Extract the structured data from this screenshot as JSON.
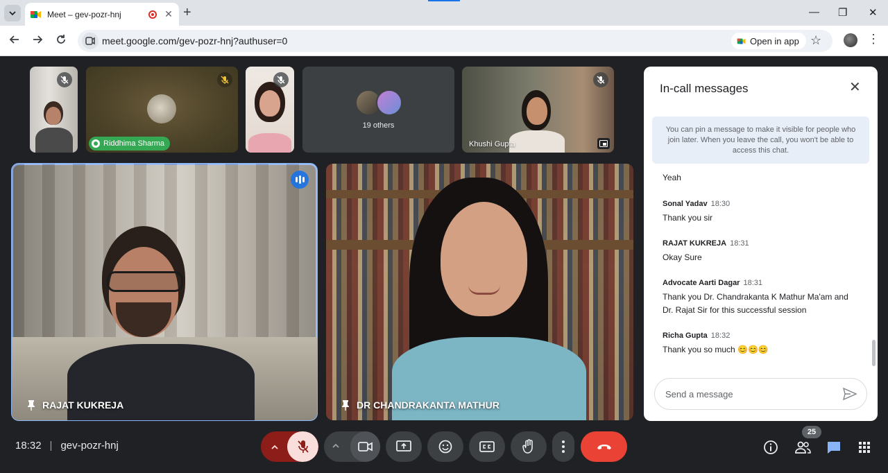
{
  "browser": {
    "tab_title": "Meet – gev-pozr-hnj",
    "new_tab_symbol": "+",
    "tab_close_symbol": "✕",
    "url": "meet.google.com/gev-pozr-hnj?authuser=0",
    "open_in_app_label": "Open in app",
    "window_minimize": "—",
    "window_restore": "❐",
    "window_close": "✕"
  },
  "filmstrip": {
    "tiles": [
      {
        "name": "",
        "muted": true
      },
      {
        "name": "Riddhima Sharma",
        "muted": true,
        "speaking": true
      },
      {
        "name": "",
        "muted": true
      },
      {
        "name": "19 others",
        "muted": false
      },
      {
        "name": "Khushi Gupta",
        "muted": true
      }
    ]
  },
  "main_tiles": [
    {
      "name": "RAJAT KUKREJA",
      "pinned": true,
      "speaking": true
    },
    {
      "name": "DR CHANDRAKANTA MATHUR",
      "pinned": true,
      "speaking": false
    }
  ],
  "chat": {
    "title": "In-call messages",
    "info": "You can pin a message to make it visible for people who join later. When you leave the call, you won't be able to access this chat.",
    "messages": [
      {
        "sender": "",
        "time": "",
        "text": "Yeah"
      },
      {
        "sender": "Sonal Yadav",
        "time": "18:30",
        "text": "Thank you sir"
      },
      {
        "sender": "RAJAT KUKREJA",
        "time": "18:31",
        "text": "Okay Sure"
      },
      {
        "sender": "Advocate Aarti Dagar",
        "time": "18:31",
        "text": "Thank you Dr. Chandrakanta K Mathur Ma'am and Dr. Rajat Sir for this successful session"
      },
      {
        "sender": "Richa Gupta",
        "time": "18:32",
        "text": "Thank you so much 😊😊😊"
      }
    ],
    "input_placeholder": "Send a message"
  },
  "bottom": {
    "time": "18:32",
    "separator": "|",
    "meeting_code": "gev-pozr-hnj",
    "participant_count": "25"
  },
  "colors": {
    "background": "#202124",
    "leave_red": "#ea4335",
    "mic_muted_bg": "#f9dedc",
    "active_outline": "#8ab4f8",
    "speaking_green": "#34a853",
    "chat_icon_blue": "#8ab4f8"
  },
  "icons": [
    "tab-list-icon",
    "meet-favicon",
    "recording-icon",
    "back-icon",
    "forward-icon",
    "reload-icon",
    "site-info-icon",
    "star-icon",
    "mic-off-icon",
    "camera-icon",
    "present-icon",
    "emoji-icon",
    "captions-icon",
    "raise-hand-icon",
    "more-icon",
    "end-call-icon",
    "info-icon",
    "people-icon",
    "chat-icon",
    "activities-icon",
    "pin-icon",
    "send-icon"
  ]
}
